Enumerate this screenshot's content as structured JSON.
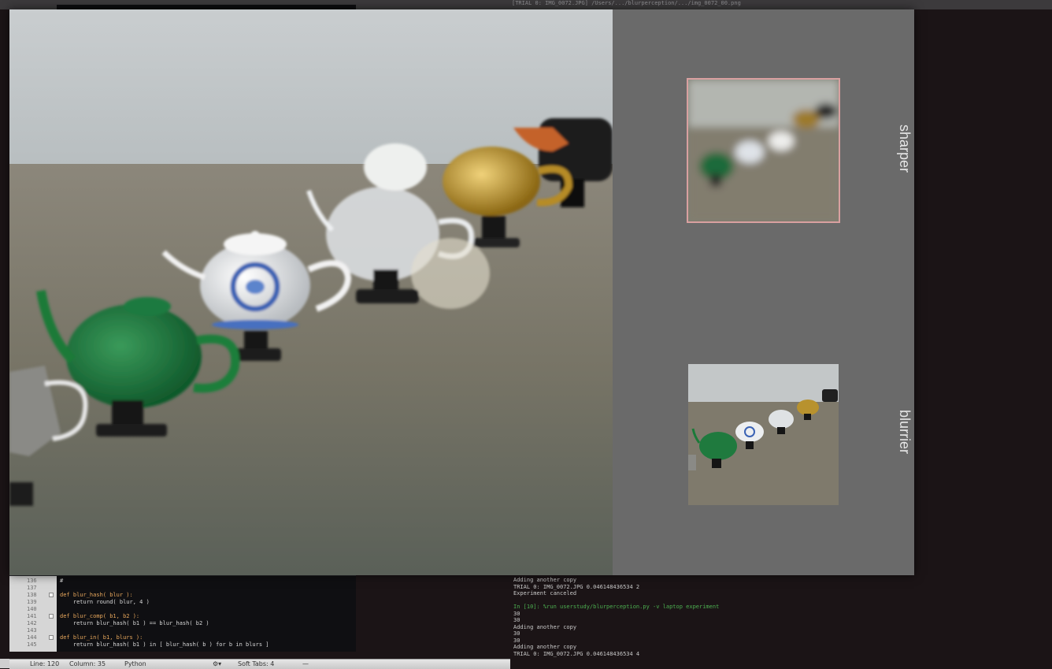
{
  "top_strip": {
    "path_text": "[TRIAL 0: IMG_0072.JPG] /Users/.../blurperception/.../img_0072_00.png"
  },
  "experiment": {
    "labels": {
      "sharper": "sharper",
      "blurrier": "blurrier"
    },
    "colors": {
      "panel_bg": "#6a6a6a",
      "selected_border": "#d9a0a0"
    }
  },
  "editor": {
    "lines": [
      {
        "num": "136",
        "code": "#",
        "fold": false
      },
      {
        "num": "137",
        "code": "",
        "fold": false
      },
      {
        "num": "138",
        "code": "def blur_hash( blur ):",
        "fold": true
      },
      {
        "num": "139",
        "code": "    return round( blur, 4 )",
        "fold": false
      },
      {
        "num": "140",
        "code": "",
        "fold": false
      },
      {
        "num": "141",
        "code": "def blur_comp( b1, b2 ):",
        "fold": true
      },
      {
        "num": "142",
        "code": "    return blur_hash( b1 ) == blur_hash( b2 )",
        "fold": false
      },
      {
        "num": "143",
        "code": "",
        "fold": false
      },
      {
        "num": "144",
        "code": "def blur_in( b1, blurs ):",
        "fold": true
      },
      {
        "num": "145",
        "code": "    return blur_hash( b1 ) in [ blur_hash( b ) for b in blurs ]",
        "fold": false
      }
    ]
  },
  "statusbar": {
    "line": "Line: 120",
    "column": "Column: 35",
    "language": "Python",
    "tabs": "Soft Tabs:  4",
    "symbol": "—"
  },
  "terminal": {
    "lines": [
      {
        "text": "Adding another copy",
        "prompt": false
      },
      {
        "text": "TRIAL 0: IMG_0072.JPG 0.046148436534 2",
        "prompt": false
      },
      {
        "text": "Experiment canceled",
        "prompt": false
      },
      {
        "text": "",
        "prompt": false
      },
      {
        "text": "In [10]: %run userstudy/blurperception.py -v laptop experiment",
        "prompt": true
      },
      {
        "text": "30",
        "prompt": false
      },
      {
        "text": "30",
        "prompt": false
      },
      {
        "text": "Adding another copy",
        "prompt": false
      },
      {
        "text": "30",
        "prompt": false
      },
      {
        "text": "30",
        "prompt": false
      },
      {
        "text": "Adding another copy",
        "prompt": false
      },
      {
        "text": "TRIAL 0: IMG_0072.JPG 0.046148436534 4",
        "prompt": false
      }
    ]
  }
}
